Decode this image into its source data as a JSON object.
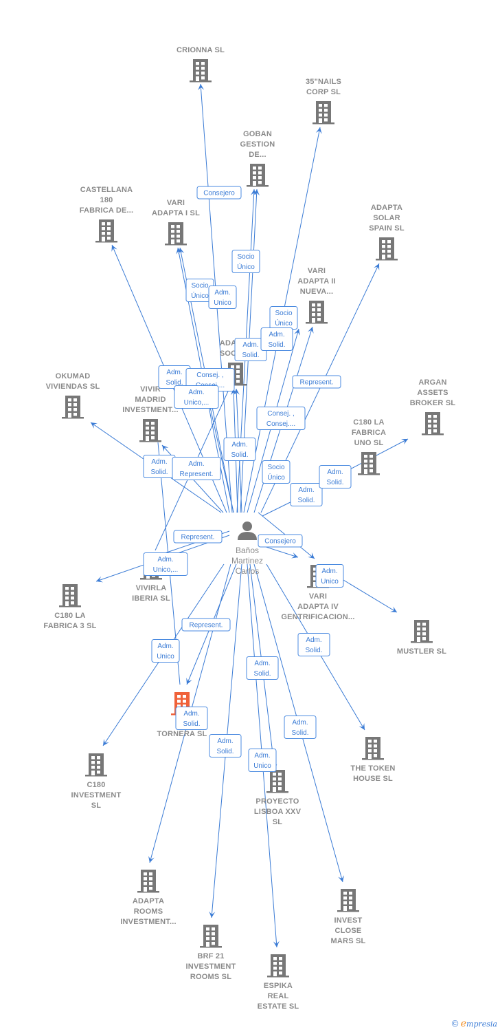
{
  "center": {
    "name_lines": [
      "Baños",
      "Martinez",
      "Carlos"
    ],
    "icon": "person-icon"
  },
  "nodes": [
    {
      "id": "crionna",
      "lines": [
        "CRIONNA  SL"
      ],
      "icon": "building-icon"
    },
    {
      "id": "35nails",
      "lines": [
        "35\"NAILS",
        "CORP  SL"
      ],
      "icon": "building-icon"
    },
    {
      "id": "goban",
      "lines": [
        "GOBAN",
        "GESTION",
        "DE..."
      ],
      "icon": "building-icon"
    },
    {
      "id": "castellana",
      "lines": [
        "CASTELLANA",
        "180",
        "FABRICA DE..."
      ],
      "icon": "building-icon"
    },
    {
      "id": "vari-adapta-i",
      "lines": [
        "VARI",
        "ADAPTA I  SL"
      ],
      "icon": "building-icon"
    },
    {
      "id": "adapta-solar",
      "lines": [
        "ADAPTA",
        "SOLAR",
        "SPAIN  SL"
      ],
      "icon": "building-icon"
    },
    {
      "id": "vari-adapta-ii",
      "lines": [
        "VARI",
        "ADAPTA II",
        "NUEVA..."
      ],
      "icon": "building-icon"
    },
    {
      "id": "adapta-socio",
      "lines": [
        "ADAPTA",
        "SOCIO..."
      ],
      "icon": "building-icon"
    },
    {
      "id": "okumad",
      "lines": [
        "OKUMAD",
        "VIVIENDAS  SL"
      ],
      "icon": "building-icon"
    },
    {
      "id": "vivir-madrid",
      "lines": [
        "VIVIR",
        "MADRID",
        "INVESTMENT..."
      ],
      "icon": "building-icon"
    },
    {
      "id": "argan",
      "lines": [
        "ARGAN",
        "ASSETS",
        "BROKER  SL"
      ],
      "icon": "building-icon"
    },
    {
      "id": "c180-uno",
      "lines": [
        "C180 LA",
        "FABRICA",
        "UNO  SL"
      ],
      "icon": "building-icon"
    },
    {
      "id": "vivirla",
      "lines": [
        "VIVIRLA",
        "IBERIA  SL"
      ],
      "icon": "building-icon"
    },
    {
      "id": "c180-3",
      "lines": [
        "C180 LA",
        "FABRICA 3  SL"
      ],
      "icon": "building-icon"
    },
    {
      "id": "vari-adapta-iv",
      "lines": [
        "VARI",
        "ADAPTA IV",
        "GENTRIFICACION..."
      ],
      "icon": "building-icon"
    },
    {
      "id": "mustler",
      "lines": [
        "MUSTLER SL"
      ],
      "icon": "building-icon"
    },
    {
      "id": "tornera",
      "lines": [
        "V...",
        "TORNERA  SL"
      ],
      "icon": "building-icon",
      "highlighted": true
    },
    {
      "id": "c180-investment",
      "lines": [
        "C180",
        "INVESTMENT",
        "SL"
      ],
      "icon": "building-icon"
    },
    {
      "id": "token-house",
      "lines": [
        "THE TOKEN",
        "HOUSE  SL"
      ],
      "icon": "building-icon"
    },
    {
      "id": "proyecto-lisboa",
      "lines": [
        "PROYECTO",
        "LISBOA XXV",
        "SL"
      ],
      "icon": "building-icon"
    },
    {
      "id": "adapta-rooms",
      "lines": [
        "ADAPTA",
        "ROOMS",
        "INVESTMENT..."
      ],
      "icon": "building-icon"
    },
    {
      "id": "brf21",
      "lines": [
        "BRF 21",
        "INVESTMENT",
        "ROOMS  SL"
      ],
      "icon": "building-icon"
    },
    {
      "id": "espika",
      "lines": [
        "ESPIKA",
        "REAL",
        "ESTATE  SL"
      ],
      "icon": "building-icon"
    },
    {
      "id": "invest-close-mars",
      "lines": [
        "INVEST",
        "CLOSE",
        "MARS  SL"
      ],
      "icon": "building-icon"
    }
  ],
  "edges": [
    {
      "to": "crionna",
      "label": [
        "Consejero"
      ]
    },
    {
      "to": "vari-adapta-i",
      "label": [
        "Socio",
        "Único"
      ]
    },
    {
      "to": "vari-adapta-i",
      "label": [
        "Adm.",
        "Unico"
      ]
    },
    {
      "to": "goban",
      "label": [
        "Socio",
        "Único"
      ]
    },
    {
      "to": "goban",
      "label": [
        "Adm.",
        "Solid."
      ]
    },
    {
      "to": "35nails",
      "label": [
        "Socio",
        "Único"
      ]
    },
    {
      "to": "vari-adapta-ii",
      "label": [
        "Adm.",
        "Solid."
      ]
    },
    {
      "to": "castellana",
      "label": [
        "Adm.",
        "Solid."
      ]
    },
    {
      "to": "adapta-socio",
      "label": [
        "Consej. ,",
        "Consej...."
      ]
    },
    {
      "to": "adapta-socio",
      "label": [
        "Adm.",
        "Unico,..."
      ]
    },
    {
      "to": "adapta-socio",
      "label": [
        "Adm.",
        "Solid."
      ]
    },
    {
      "to": "adapta-solar",
      "label": [
        "Represent."
      ]
    },
    {
      "to": "vari-adapta-ii",
      "label": [
        "Consej. ,",
        "Consej...."
      ]
    },
    {
      "to": "okumad",
      "label": [
        "Adm.",
        "Solid."
      ]
    },
    {
      "to": "vivir-madrid",
      "label": [
        "Adm.",
        "Represent."
      ]
    },
    {
      "to": "vari-adapta-iv",
      "label": [
        "Socio",
        "Único"
      ]
    },
    {
      "to": "c180-uno",
      "label": [
        "Adm.",
        "Solid."
      ]
    },
    {
      "to": "argan",
      "label": [
        "Adm.",
        "Solid."
      ]
    },
    {
      "to": "vivirla",
      "label": [
        "Represent."
      ]
    },
    {
      "to": "c180-3",
      "label": [
        "Adm.",
        "Unico,..."
      ]
    },
    {
      "to": "vari-adapta-iv",
      "label": [
        "Consejero"
      ]
    },
    {
      "to": "mustler",
      "label": [
        "Adm.",
        "Unico"
      ]
    },
    {
      "to": "tornera",
      "label": [
        "Represent."
      ]
    },
    {
      "to": "c180-investment",
      "label": [
        "Adm.",
        "Unico"
      ]
    },
    {
      "to": "token-house",
      "label": [
        "Adm.",
        "Solid."
      ]
    },
    {
      "to": "adapta-rooms",
      "label": [
        "Adm.",
        "Solid."
      ]
    },
    {
      "to": "brf21",
      "label": [
        "Adm.",
        "Solid."
      ]
    },
    {
      "to": "proyecto-lisboa",
      "label": [
        "Adm.",
        "Solid."
      ]
    },
    {
      "to": "espika",
      "label": [
        "Adm.",
        "Unico"
      ]
    },
    {
      "to": "invest-close-mars",
      "label": [
        "Adm.",
        "Solid."
      ]
    }
  ],
  "brand": {
    "copyright": "©",
    "initial": "e",
    "rest": "mpresia"
  },
  "colors": {
    "edge": "#3a7bd5",
    "node_icon": "#777777",
    "highlight": "#f0623a",
    "label_text": "#8a8a8a"
  }
}
